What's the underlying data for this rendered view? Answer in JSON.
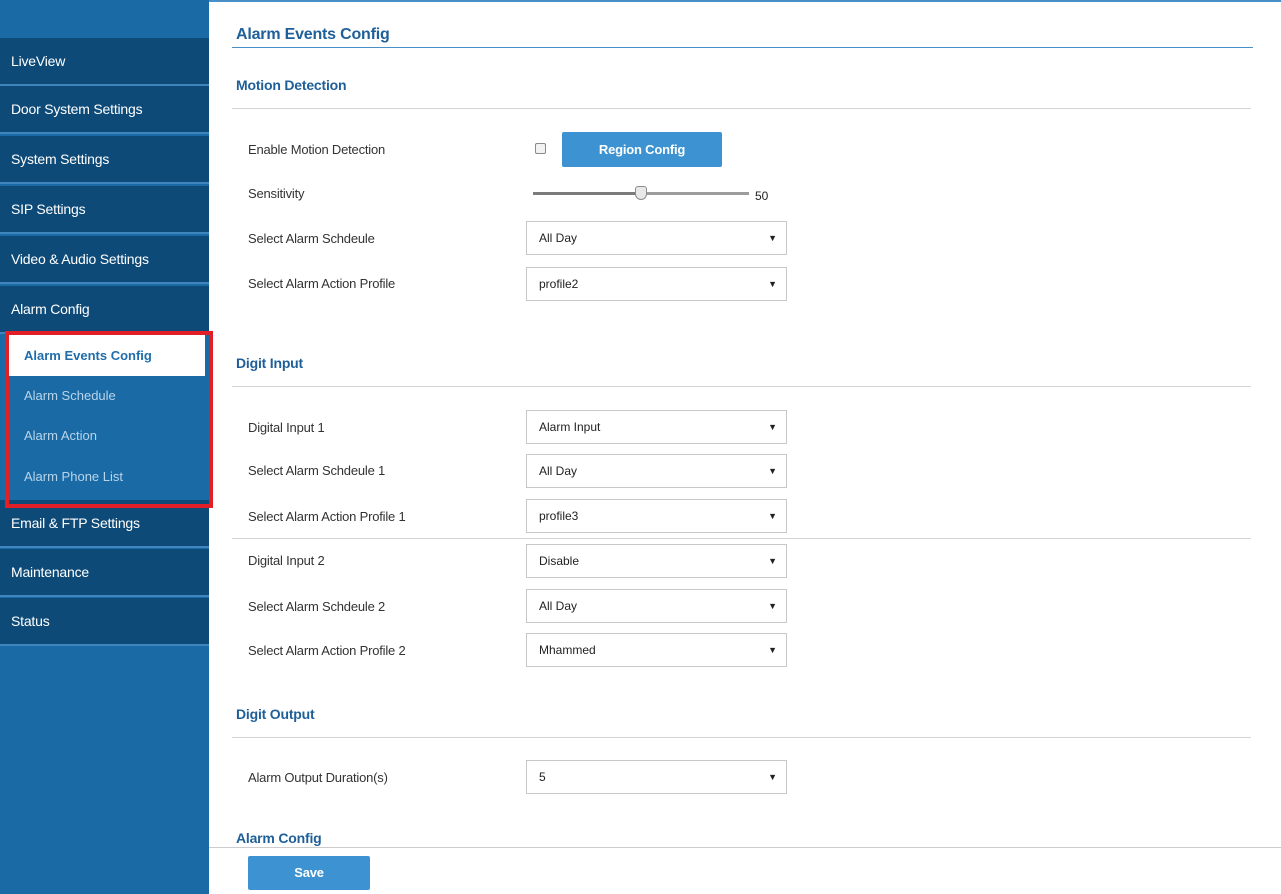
{
  "sidebar": {
    "items": [
      {
        "label": "LiveView"
      },
      {
        "label": "Door System Settings"
      },
      {
        "label": "System Settings"
      },
      {
        "label": "SIP Settings"
      },
      {
        "label": "Video & Audio Settings"
      },
      {
        "label": "Alarm Config"
      },
      {
        "label": "Email & FTP Settings"
      },
      {
        "label": "Maintenance"
      },
      {
        "label": "Status"
      }
    ],
    "submenu": [
      {
        "label": "Alarm Events Config",
        "active": true
      },
      {
        "label": "Alarm Schedule",
        "active": false
      },
      {
        "label": "Alarm Action",
        "active": false
      },
      {
        "label": "Alarm Phone List",
        "active": false
      }
    ]
  },
  "main": {
    "title": "Alarm Events Config",
    "motion": {
      "title": "Motion Detection",
      "enable_label": "Enable Motion Detection",
      "enable_checked": false,
      "region_button": "Region Config",
      "sensitivity_label": "Sensitivity",
      "sensitivity_value": "50",
      "sensitivity_max": 100,
      "schedule_label": "Select Alarm Schdeule",
      "schedule_value": "All Day",
      "profile_label": "Select Alarm Action Profile",
      "profile_value": "profile2"
    },
    "digit_input": {
      "title": "Digit Input",
      "input1_label": "Digital Input 1",
      "input1_value": "Alarm Input",
      "schedule1_label": "Select Alarm Schdeule 1",
      "schedule1_value": "All Day",
      "profile1_label": "Select Alarm Action Profile 1",
      "profile1_value": "profile3",
      "input2_label": "Digital Input 2",
      "input2_value": "Disable",
      "schedule2_label": "Select Alarm Schdeule 2",
      "schedule2_value": "All Day",
      "profile2_label": "Select Alarm Action Profile 2",
      "profile2_value": "Mhammed"
    },
    "digit_output": {
      "title": "Digit Output",
      "duration_label": "Alarm Output Duration(s)",
      "duration_value": "5"
    },
    "alarm_config": {
      "title": "Alarm Config"
    },
    "save_button": "Save"
  },
  "colors": {
    "nav_bg": "#0d4a78",
    "sidebar_bg": "#1a6aa6",
    "accent": "#3d93d1",
    "highlight": "#e21f26",
    "heading": "#1f5f99"
  }
}
